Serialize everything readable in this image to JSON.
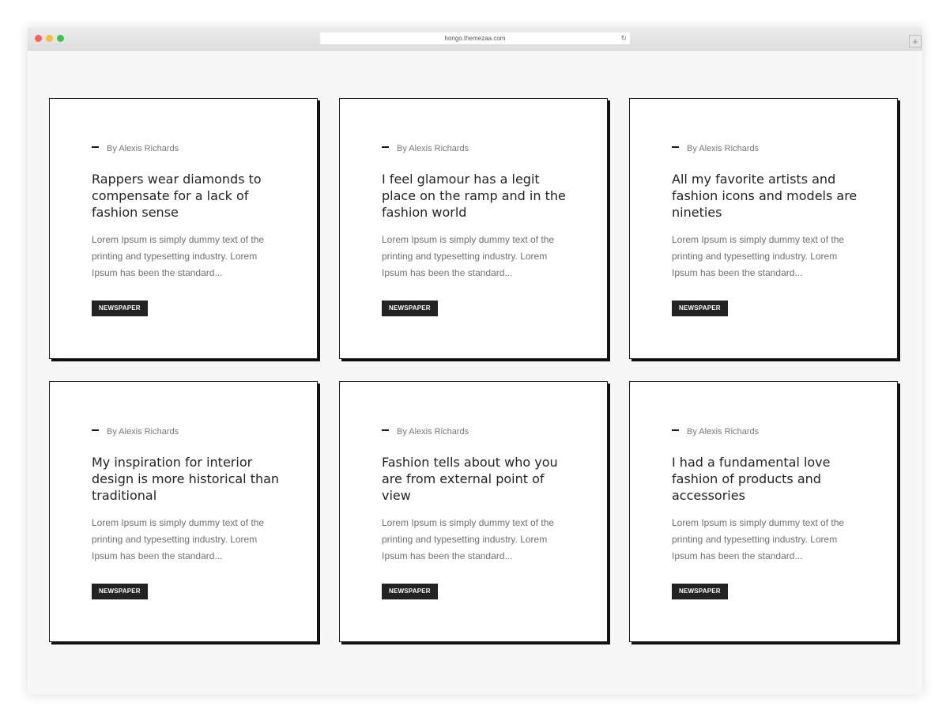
{
  "browser": {
    "url": "hongo.themezaa.com",
    "newtab_label": "+"
  },
  "colors": {
    "card_border": "#1a1a1a",
    "tag_bg": "#232323",
    "page_bg": "#f7f7f7"
  },
  "cards": [
    {
      "author": "By Alexis Richards",
      "title": "Rappers wear diamonds to compensate for a lack of fashion sense",
      "excerpt": "Lorem Ipsum is simply dummy text of the printing and typesetting industry. Lorem Ipsum has been the standard...",
      "tag": "NEWSPAPER"
    },
    {
      "author": "By Alexis Richards",
      "title": "I feel glamour has a legit place on the ramp and in the fashion world",
      "excerpt": "Lorem Ipsum is simply dummy text of the printing and typesetting industry. Lorem Ipsum has been the standard...",
      "tag": "NEWSPAPER"
    },
    {
      "author": "By Alexis Richards",
      "title": "All my favorite artists and fashion icons and models are nineties",
      "excerpt": "Lorem Ipsum is simply dummy text of the printing and typesetting industry. Lorem Ipsum has been the standard...",
      "tag": "NEWSPAPER"
    },
    {
      "author": "By Alexis Richards",
      "title": "My inspiration for interior design is more historical than traditional",
      "excerpt": "Lorem Ipsum is simply dummy text of the printing and typesetting industry. Lorem Ipsum has been the standard...",
      "tag": "NEWSPAPER"
    },
    {
      "author": "By Alexis Richards",
      "title": "Fashion tells about who you are from external point of view",
      "excerpt": "Lorem Ipsum is simply dummy text of the printing and typesetting industry. Lorem Ipsum has been the standard...",
      "tag": "NEWSPAPER"
    },
    {
      "author": "By Alexis Richards",
      "title": "I had a fundamental love fashion of products and accessories",
      "excerpt": "Lorem Ipsum is simply dummy text of the printing and typesetting industry. Lorem Ipsum has been the standard...",
      "tag": "NEWSPAPER"
    }
  ]
}
